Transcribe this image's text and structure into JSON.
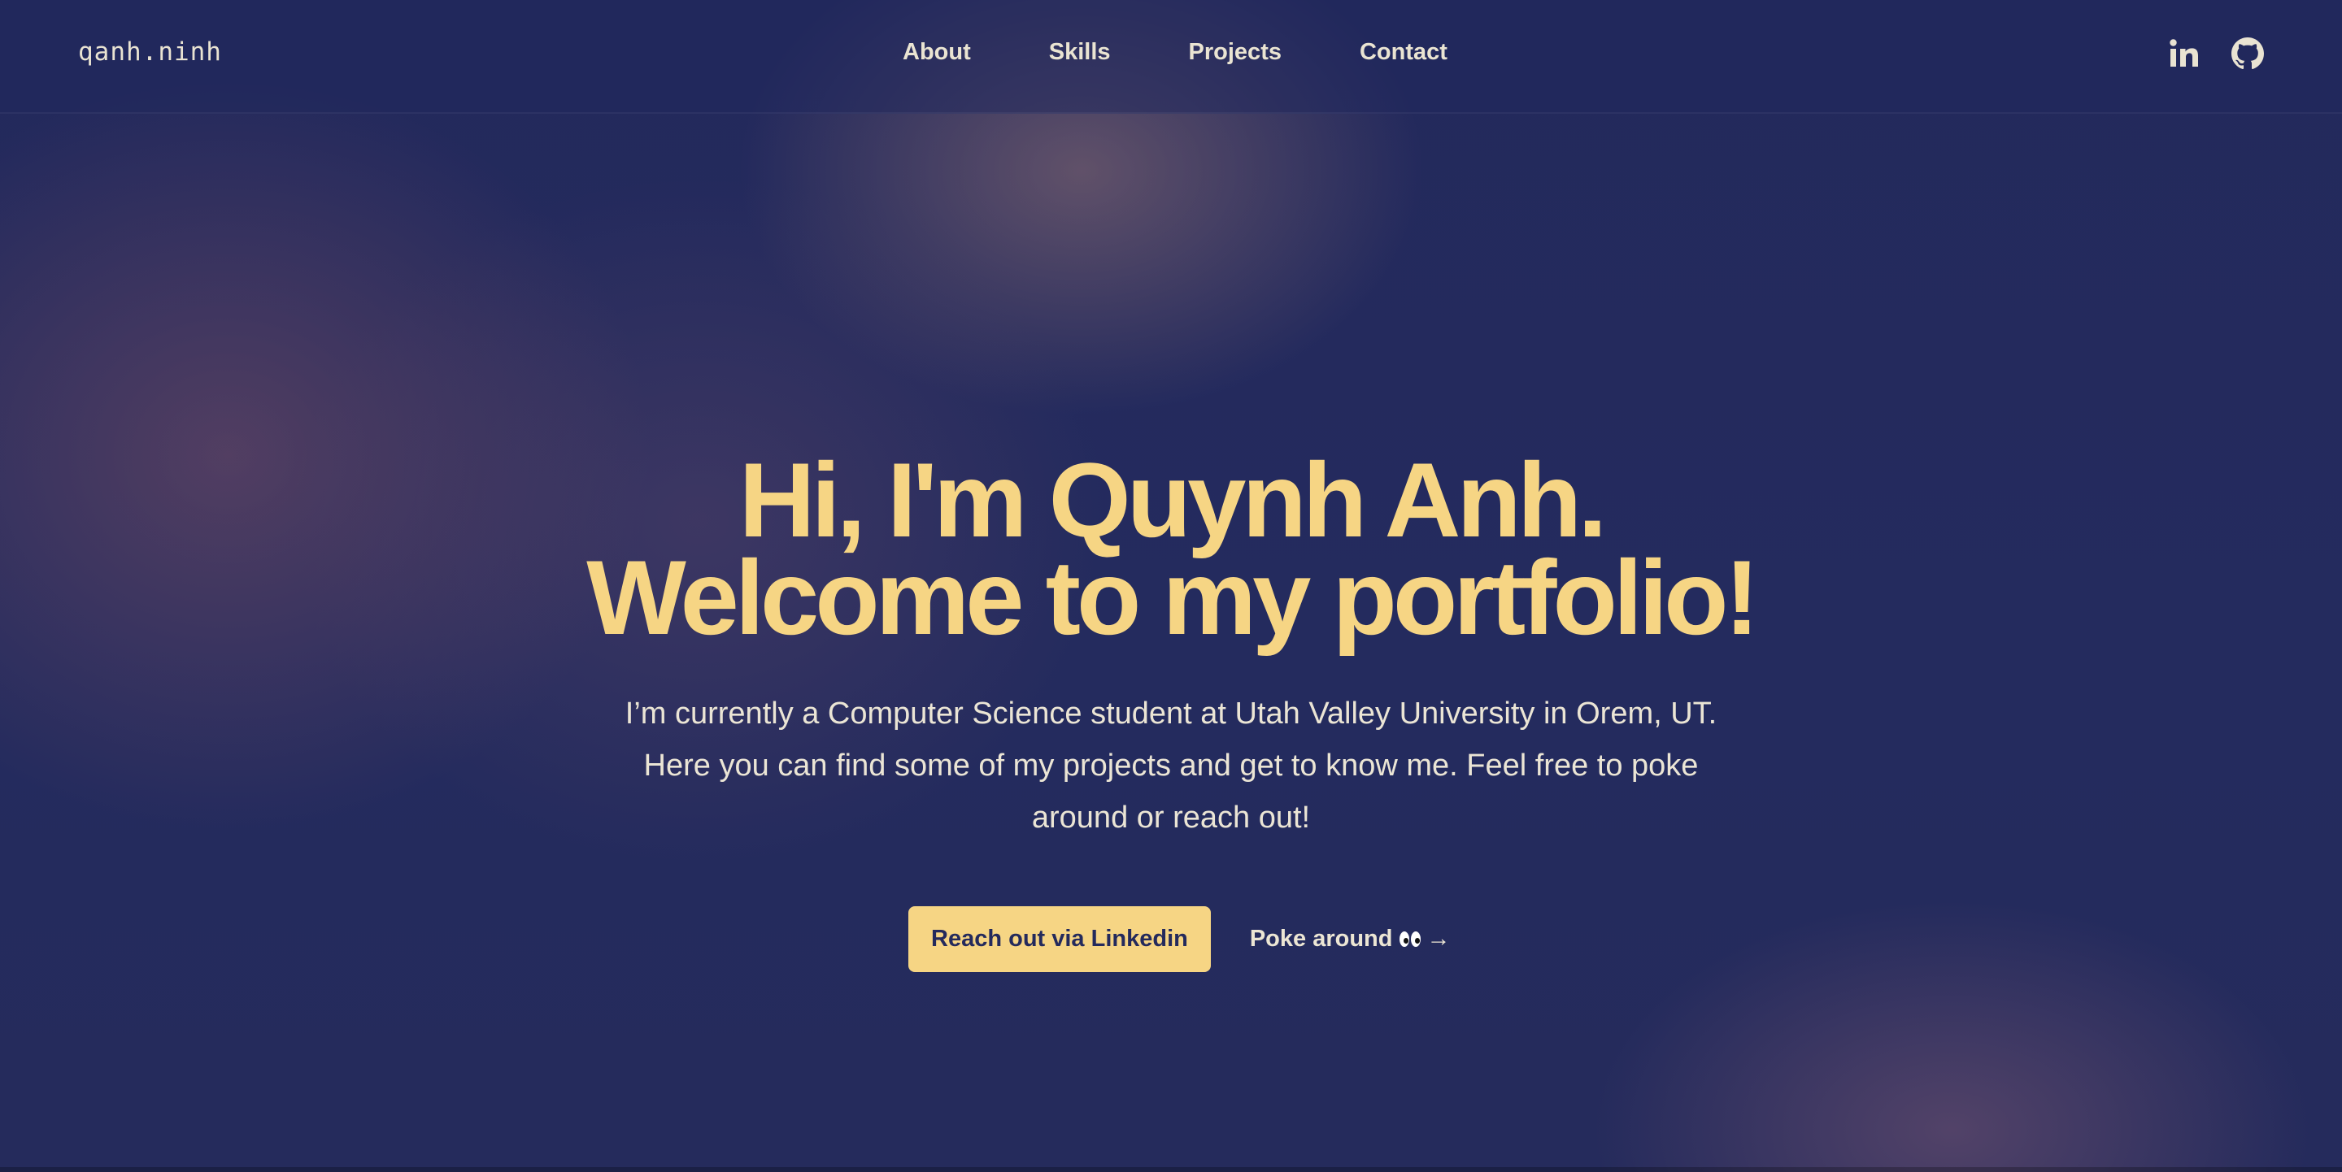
{
  "brand": "qanh.ninh",
  "nav": {
    "links": [
      "About",
      "Skills",
      "Projects",
      "Contact"
    ]
  },
  "social": {
    "icons": [
      "linkedin-icon",
      "github-icon"
    ]
  },
  "hero": {
    "headline_line1": "Hi, I'm Quynh Anh.",
    "headline_line2": "Welcome to my portfolio!",
    "intro_line1": "I’m currently a Computer Science student at Utah Valley University in Orem, UT.",
    "intro_line2": "Here you can find some of my projects and get to know me. Feel free to poke",
    "intro_line3": "around or reach out!",
    "primary_cta": "Reach out via Linkedin",
    "secondary_cta": "Poke around",
    "secondary_cta_arrow": "→"
  },
  "colors": {
    "background": "#222a5c",
    "accent": "#f6d584",
    "text": "#ebe5d5"
  }
}
